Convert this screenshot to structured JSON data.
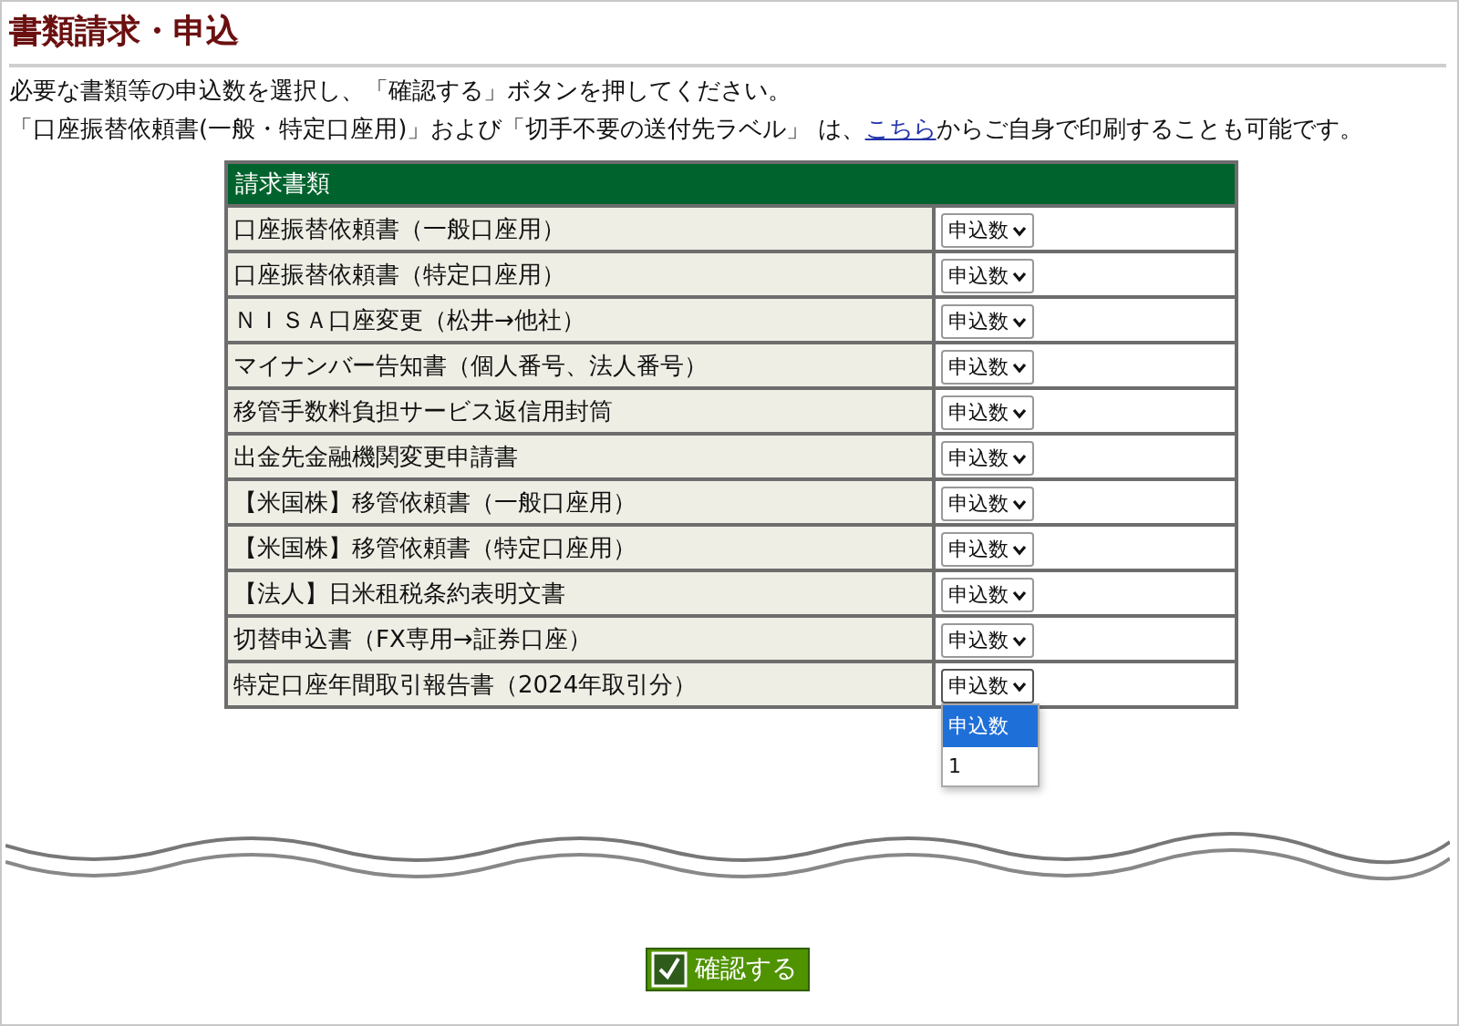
{
  "page_title": "書類請求・申込",
  "instructions": {
    "line_1": "必要な書類等の申込数を選択し、「確認する」ボタンを押してください。",
    "line_2_before": "「口座振替依頼書(一般・特定口座用)」および「切手不要の送付先ラベル」 は、",
    "line_2_link": "こちら",
    "line_2_after": "からご自身で印刷することも可能です。"
  },
  "table": {
    "header": "請求書類",
    "rows": [
      {
        "document": "口座振替依頼書（一般口座用）",
        "select": "申込数",
        "expanded": false
      },
      {
        "document": "口座振替依頼書（特定口座用）",
        "select": "申込数",
        "expanded": false
      },
      {
        "document": "ＮＩＳＡ口座変更（松井→他社）",
        "select": "申込数",
        "expanded": false
      },
      {
        "document": "マイナンバー告知書（個人番号、法人番号）",
        "select": "申込数",
        "expanded": false
      },
      {
        "document": "移管手数料負担サービス返信用封筒",
        "select": "申込数",
        "expanded": false
      },
      {
        "document": "出金先金融機関変更申請書",
        "select": "申込数",
        "expanded": false
      },
      {
        "document": "【米国株】移管依頼書（一般口座用）",
        "select": "申込数",
        "expanded": false
      },
      {
        "document": "【米国株】移管依頼書（特定口座用）",
        "select": "申込数",
        "expanded": false
      },
      {
        "document": "【法人】日米租税条約表明文書",
        "select": "申込数",
        "expanded": false
      },
      {
        "document": "切替申込書（FX専用→証券口座）",
        "select": "申込数",
        "expanded": false
      },
      {
        "document": "特定口座年間取引報告書（2024年取引分）",
        "select": "申込数",
        "expanded": true
      }
    ]
  },
  "dropdown_options": [
    {
      "label": "申込数",
      "selected": true
    },
    {
      "label": "1",
      "selected": false
    }
  ],
  "confirm_button": "確認する"
}
